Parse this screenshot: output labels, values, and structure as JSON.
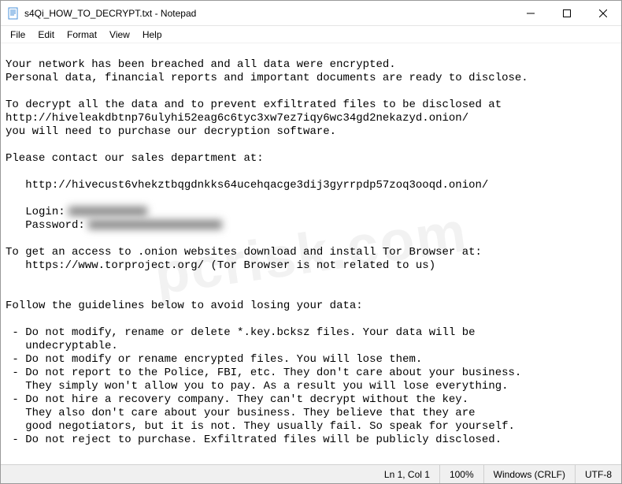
{
  "titlebar": {
    "title": "s4Qi_HOW_TO_DECRYPT.txt - Notepad"
  },
  "menu": {
    "file": "File",
    "edit": "Edit",
    "format": "Format",
    "view": "View",
    "help": "Help"
  },
  "content": {
    "line1": "Your network has been breached and all data were encrypted.",
    "line2": "Personal data, financial reports and important documents are ready to disclose.",
    "line3": "",
    "line4": "To decrypt all the data and to prevent exfiltrated files to be disclosed at",
    "line5": "http://hiveleakdbtnp76ulyhi52eag6c6tyc3xw7ez7iqy6wc34gd2nekazyd.onion/",
    "line6": "you will need to purchase our decryption software.",
    "line7": "",
    "line8": "Please contact our sales department at:",
    "line9": "",
    "line10": "   http://hivecust6vhekztbqgdnkks64ucehqacge3dij3gyrrpdp57zoq3ooqd.onion/",
    "line11": "",
    "line12a": "   Login:",
    "line13a": "   Password:",
    "line14": "",
    "line15": "To get an access to .onion websites download and install Tor Browser at:",
    "line16": "   https://www.torproject.org/ (Tor Browser is not related to us)",
    "line17": "",
    "line18": "",
    "line19": "Follow the guidelines below to avoid losing your data:",
    "line20": "",
    "line21": " - Do not modify, rename or delete *.key.bcksz files. Your data will be",
    "line22": "   undecryptable.",
    "line23": " - Do not modify or rename encrypted files. You will lose them.",
    "line24": " - Do not report to the Police, FBI, etc. They don't care about your business.",
    "line25": "   They simply won't allow you to pay. As a result you will lose everything.",
    "line26": " - Do not hire a recovery company. They can't decrypt without the key.",
    "line27": "   They also don't care about your business. They believe that they are",
    "line28": "   good negotiators, but it is not. They usually fail. So speak for yourself.",
    "line29": " - Do not reject to purchase. Exfiltrated files will be publicly disclosed."
  },
  "statusbar": {
    "position": "Ln 1, Col 1",
    "zoom": "100%",
    "lineending": "Windows (CRLF)",
    "encoding": "UTF-8"
  },
  "watermark": "pcrisk.com"
}
